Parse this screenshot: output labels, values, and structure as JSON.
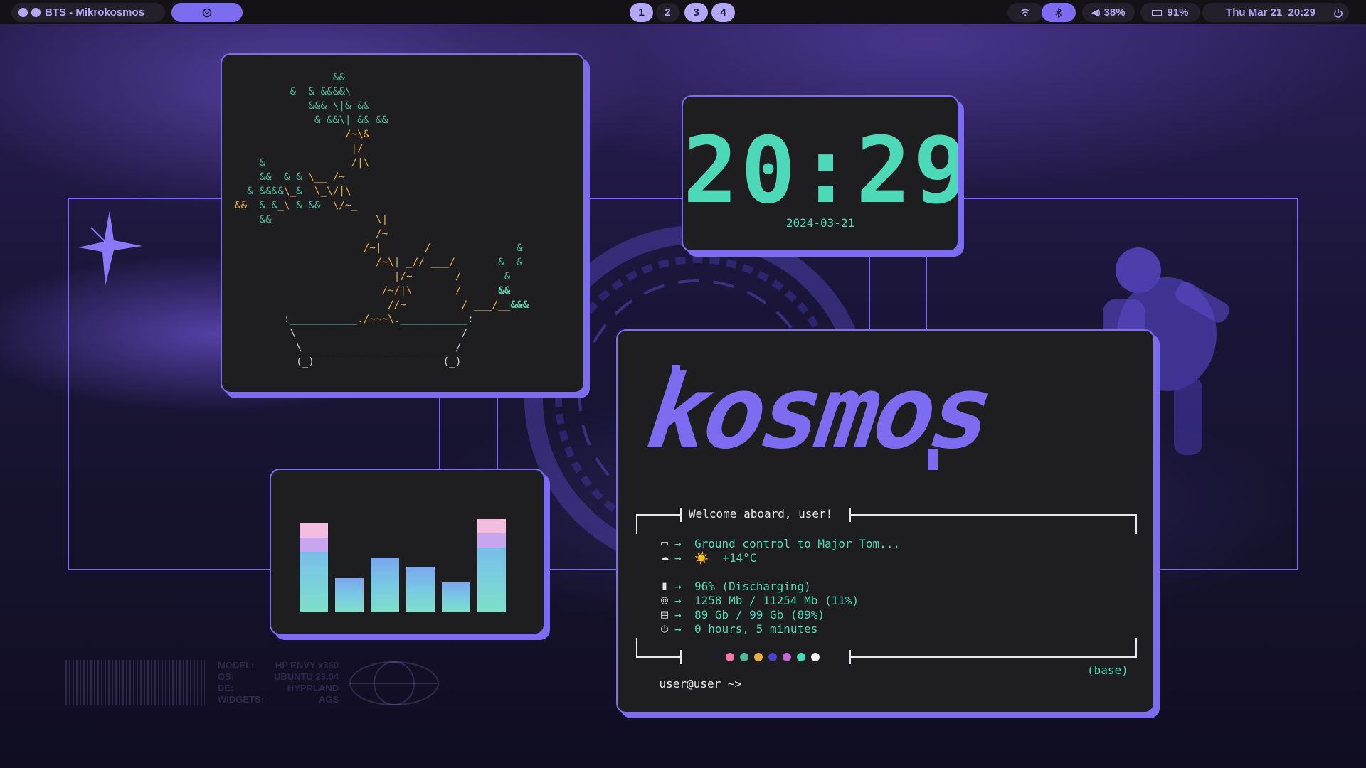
{
  "topbar": {
    "media_title": "BTS - Mikrokosmos",
    "workspaces": [
      "1",
      "2",
      "3",
      "4"
    ],
    "volume": "38%",
    "battery": "91%",
    "datetime": "Thu Mar 21  20:29"
  },
  "clock": {
    "time": "20:29",
    "date": "2024-03-21"
  },
  "visualizer": {
    "levels": [
      0.78,
      0.3,
      0.48,
      0.4,
      0.26,
      0.82
    ],
    "caps": [
      true,
      false,
      false,
      false,
      false,
      true
    ]
  },
  "terminal": {
    "logo": "kosmos",
    "welcome": "Welcome aboard, user!",
    "lines": [
      {
        "icon": "chat-icon",
        "text": "Ground control to Major Tom..."
      },
      {
        "icon": "cloud-icon",
        "text": "☀️  +14°C"
      },
      {
        "icon": "battery-icon",
        "text": "96% (Discharging)"
      },
      {
        "icon": "chip-icon",
        "text": "1258 Mb / 11254 Mb (11%)"
      },
      {
        "icon": "disk-icon",
        "text": "89 Gb / 99 Gb (89%)"
      },
      {
        "icon": "clock-icon",
        "text": "0 hours, 5 minutes"
      }
    ],
    "arrow": "→",
    "palette": [
      "#1e1d2a",
      "#f07aa8",
      "#4fb89a",
      "#e8b04a",
      "#4a45c8",
      "#c46ad8",
      "#4dd9b8",
      "#f3f3f3"
    ],
    "prompt_user": "user",
    "prompt_host": "@user",
    "prompt_sym": " ~>",
    "env": "(base)"
  },
  "sysinfo": {
    "labels": [
      "MODEL:",
      "OS:",
      "DE:",
      "WIDGETS:"
    ],
    "values": [
      "HP ENVY x360",
      "UBUNTU 23.04",
      "HYPRLAND",
      "AGS"
    ]
  },
  "colors": {
    "accent": "#7d6cf0",
    "teal": "#4dd9b8",
    "panel": "#1e1d1f"
  }
}
